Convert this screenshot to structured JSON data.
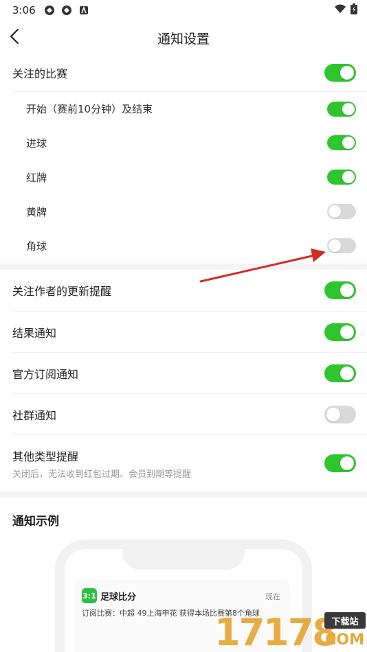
{
  "status_bar": {
    "time": "3:06",
    "icons": [
      "app-icon-1",
      "app-icon-2",
      "app-icon-3"
    ],
    "right_icons": [
      "wifi-icon",
      "battery-icon"
    ]
  },
  "nav": {
    "title": "通知设置",
    "back_icon": "chevron-left-icon"
  },
  "match_follow": {
    "label": "关注的比赛",
    "on": true,
    "items": [
      {
        "label": "开始（赛前10分钟）及结束",
        "on": true
      },
      {
        "label": "进球",
        "on": true
      },
      {
        "label": "红牌",
        "on": true
      },
      {
        "label": "黄牌",
        "on": false
      },
      {
        "label": "角球",
        "on": false
      }
    ]
  },
  "settings": [
    {
      "label": "关注作者的更新提醒",
      "on": true
    },
    {
      "label": "结果通知",
      "on": true
    },
    {
      "label": "官方订阅通知",
      "on": true
    },
    {
      "label": "社群通知",
      "on": false
    },
    {
      "label": "其他类型提醒",
      "hint": "关闭后，无法收到红包过期、会员到期等提醒",
      "on": true
    }
  ],
  "example": {
    "title": "通知示例",
    "app_icon_text": "3:1",
    "app_name": "足球比分",
    "when": "现在",
    "body": "订阅比赛：中超 49上海申花 获得本场比赛第8个角球"
  },
  "watermark": {
    "digits": "17178",
    "badge": "下载站",
    "suffix": ".COM"
  },
  "colors": {
    "toggle_on": "#2fc52f",
    "toggle_off": "#d9d9d9",
    "arrow": "#d42a2a"
  }
}
